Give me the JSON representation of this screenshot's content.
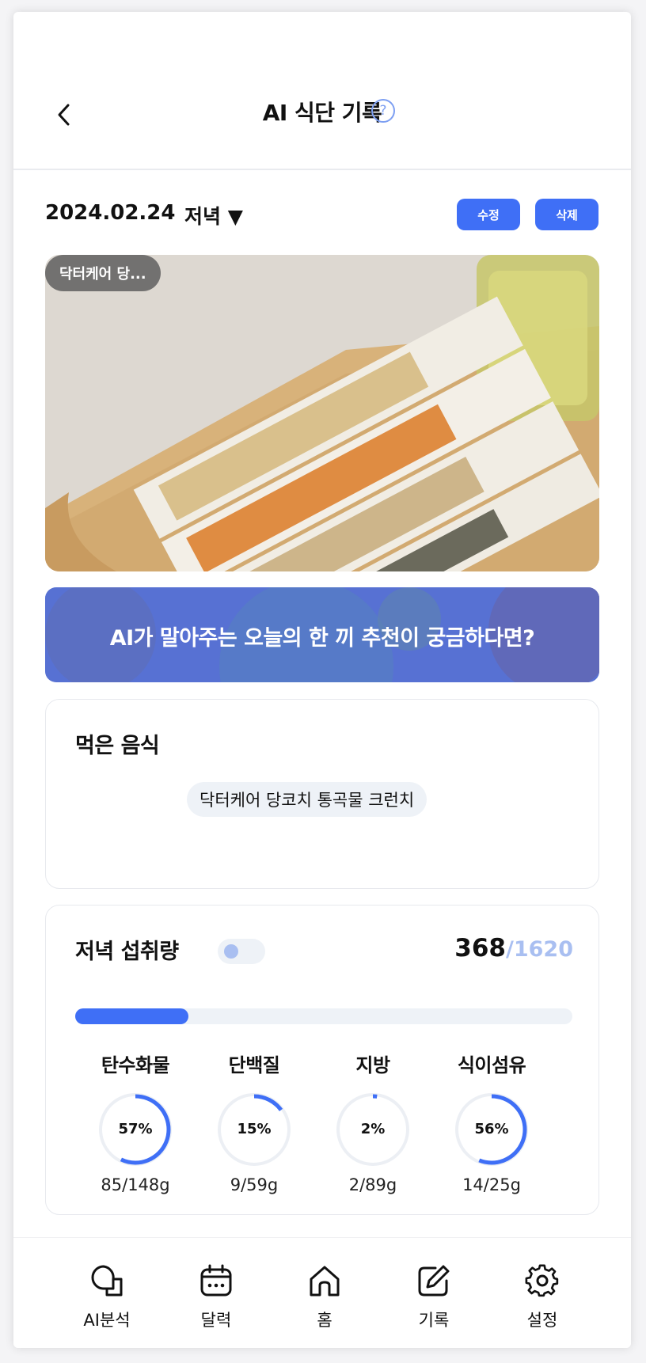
{
  "header": {
    "title": "AI 식단 기록"
  },
  "record": {
    "date": "2024.02.24",
    "meal": "저녁 ▼",
    "edit_label": "수정",
    "delete_label": "삭제"
  },
  "photo": {
    "tag": "닥터케어 당..."
  },
  "banner": {
    "text": "AI가 말아주는 오늘의 한 끼 추천이 궁금하다면?"
  },
  "foods": {
    "title": "먹은 음식",
    "items": [
      "닥터케어 당코치 통곡물 크런치"
    ]
  },
  "intake": {
    "title": "저녁 섭취량",
    "kcal": "368",
    "goal": "/1620",
    "progress_fraction": 0.227,
    "nutrients": [
      {
        "label": "탄수화물",
        "percent": "57%",
        "amount": "85/148g",
        "fraction": 0.57
      },
      {
        "label": "단백질",
        "percent": "15%",
        "amount": "9/59g",
        "fraction": 0.15
      },
      {
        "label": "지방",
        "percent": "2%",
        "amount": "2/89g",
        "fraction": 0.02
      },
      {
        "label": "식이섬유",
        "percent": "56%",
        "amount": "14/25g",
        "fraction": 0.56
      }
    ]
  },
  "tabbar": {
    "items": [
      {
        "label": "AI분석",
        "icon": "chat-bubbles-icon"
      },
      {
        "label": "달력",
        "icon": "calendar-icon"
      },
      {
        "label": "홈",
        "icon": "home-icon"
      },
      {
        "label": "기록",
        "icon": "edit-note-icon"
      },
      {
        "label": "설정",
        "icon": "gear-icon"
      }
    ]
  },
  "colors": {
    "accent": "#3f6ff6",
    "light_accent": "#a9bff1",
    "chip_bg": "#eef2f7"
  }
}
